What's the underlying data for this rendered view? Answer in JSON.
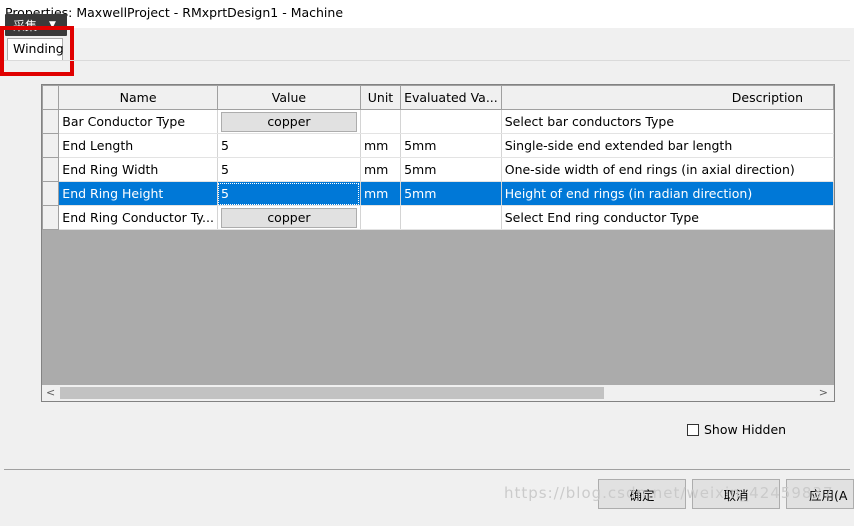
{
  "window": {
    "title": "Properties: MaxwellProject - RMxprtDesign1 - Machine"
  },
  "overlay": {
    "capture_label": "采集"
  },
  "tabs": [
    {
      "label": "Winding"
    }
  ],
  "table": {
    "columns": [
      "Name",
      "Value",
      "Unit",
      "Evaluated Va...",
      "Description"
    ],
    "rows": [
      {
        "name": "Bar Conductor Type",
        "value": "copper",
        "value_kind": "button",
        "unit": "",
        "evaluated": "",
        "description": "Select bar conductors Type"
      },
      {
        "name": "End Length",
        "value": "5",
        "value_kind": "text",
        "unit": "mm",
        "evaluated": "5mm",
        "description": "Single-side end extended bar length"
      },
      {
        "name": "End Ring Width",
        "value": "5",
        "value_kind": "text",
        "unit": "mm",
        "evaluated": "5mm",
        "description": "One-side width of end rings (in axial direction)"
      },
      {
        "name": "End Ring Height",
        "value": "5",
        "value_kind": "text",
        "unit": "mm",
        "evaluated": "5mm",
        "description": "Height of  end rings (in radian direction)",
        "selected": true
      },
      {
        "name": "End Ring Conductor Ty...",
        "value": "copper",
        "value_kind": "button",
        "unit": "",
        "evaluated": "",
        "description": "Select End ring conductor Type"
      }
    ]
  },
  "options": {
    "show_hidden_label": "Show Hidden",
    "show_hidden_checked": false
  },
  "buttons": {
    "ok": "确定",
    "cancel": "取消",
    "apply": "应用(A"
  },
  "watermark": "https://blog.csdn.net/weixin_42459837",
  "colors": {
    "selection": "#0078d7",
    "highlight_box": "#e00000"
  }
}
